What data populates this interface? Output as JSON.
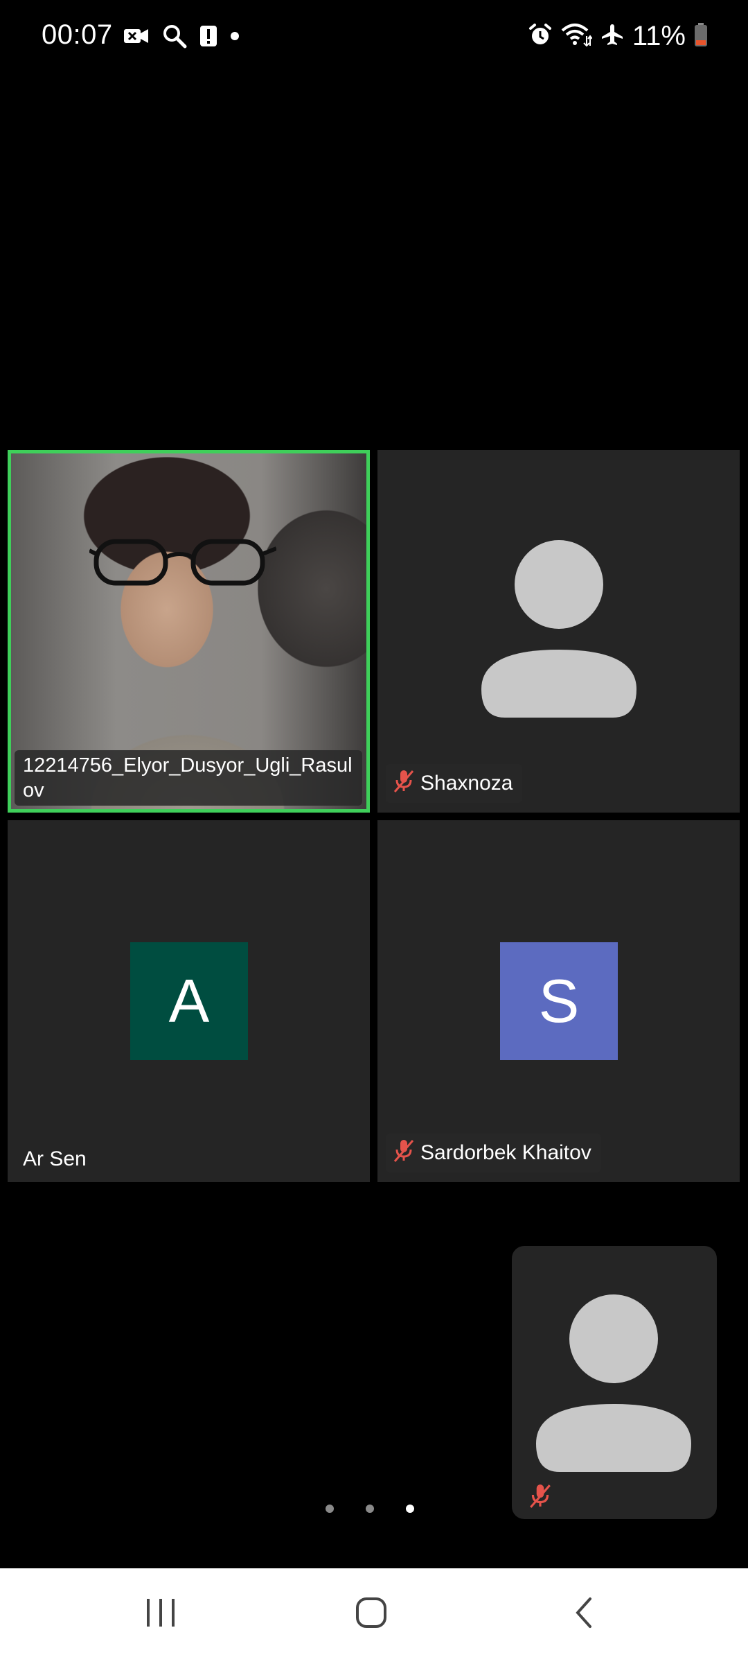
{
  "status_bar": {
    "time": "00:07",
    "battery_percent": "11%",
    "left_icons": [
      "video-call-icon",
      "search-icon",
      "alert-icon",
      "dot-icon"
    ],
    "right_icons": [
      "alarm-icon",
      "wifi-icon",
      "airplane-icon",
      "battery-icon"
    ]
  },
  "participants": [
    {
      "name": "12214756_Elyor_Dusyor_Ugli_Rasulov",
      "video_on": true,
      "active_speaker": true,
      "muted": false
    },
    {
      "name": "Shaxnoza",
      "video_on": false,
      "avatar": "silhouette",
      "muted": true
    },
    {
      "name": "Ar Sen",
      "video_on": false,
      "initial": "A",
      "avatar_color": "#004d40",
      "muted": false
    },
    {
      "name": "Sardorbek Khaitov",
      "video_on": false,
      "initial": "S",
      "avatar_color": "#5c6bc0",
      "muted": true
    }
  ],
  "self_view": {
    "muted": true,
    "avatar": "silhouette"
  },
  "pagination": {
    "pages": 3,
    "current": 3
  },
  "colors": {
    "active_border": "#3fcf5a",
    "muted_icon": "#e5534b",
    "tile_bg": "#252525"
  },
  "nav_bar": {
    "buttons": [
      "recents-button",
      "home-button",
      "back-button"
    ]
  }
}
